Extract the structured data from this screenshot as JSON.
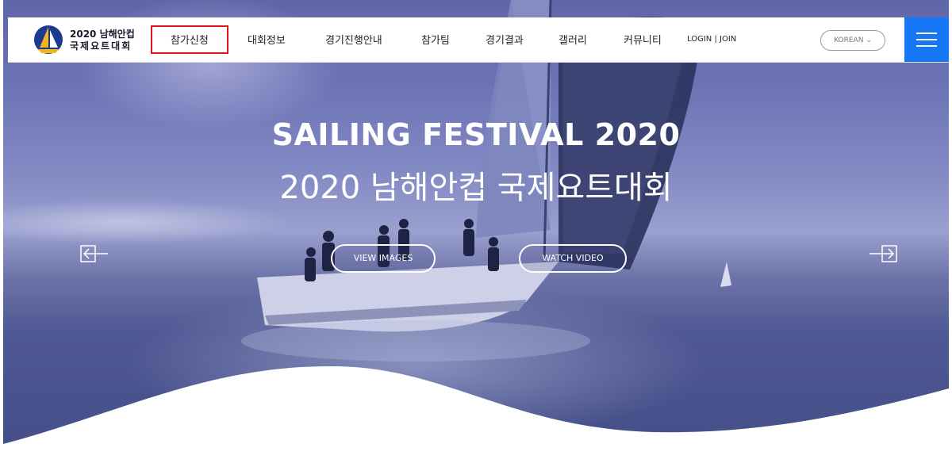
{
  "brand": {
    "line1": "2020 남해안컵",
    "line2": "국제요트대회"
  },
  "nav": {
    "items": [
      "참가신청",
      "대회정보",
      "경기진행안내",
      "참가팀",
      "경기결과",
      "갤러리",
      "커뮤니티"
    ],
    "highlighted_index": 0,
    "highlight_color": "#e0141b"
  },
  "auth": {
    "login": "LOGIN",
    "separator": "|",
    "join": "JOIN"
  },
  "language": {
    "label": "KOREAN",
    "caret": "⌄"
  },
  "menu": {
    "icon": "hamburger-icon",
    "color": "#1676f3"
  },
  "hero": {
    "title_en": "SAILING FESTIVAL 2020",
    "title_ko": "2020 남해안컵 국제요트대회",
    "buttons": [
      "VIEW IMAGES",
      "WATCH VIDEO"
    ],
    "prev_icon": "arrow-left-icon",
    "next_icon": "arrow-right-icon"
  }
}
